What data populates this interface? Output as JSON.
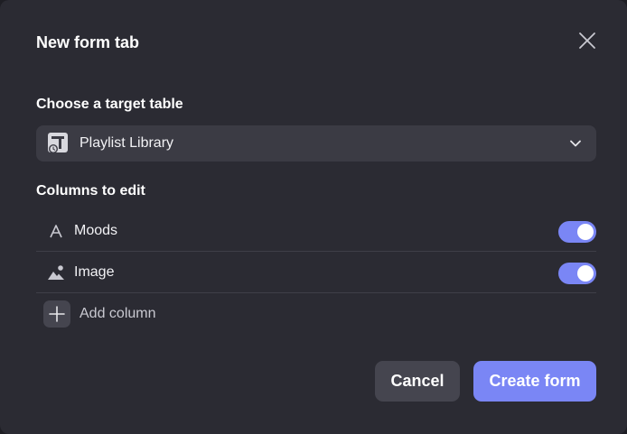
{
  "dialog": {
    "title": "New form tab",
    "close_icon": "close-icon"
  },
  "target_table": {
    "label": "Choose a target table",
    "selected_value": "Playlist Library",
    "icon": "table-icon"
  },
  "columns": {
    "label": "Columns to edit",
    "items": [
      {
        "label": "Moods",
        "icon": "text-icon",
        "enabled": true
      },
      {
        "label": "Image",
        "icon": "image-icon",
        "enabled": true
      }
    ],
    "add_label": "Add column"
  },
  "actions": {
    "cancel_label": "Cancel",
    "create_label": "Create form"
  },
  "colors": {
    "accent": "#7a86f5",
    "background": "#2b2b33",
    "field": "#3b3b44"
  }
}
